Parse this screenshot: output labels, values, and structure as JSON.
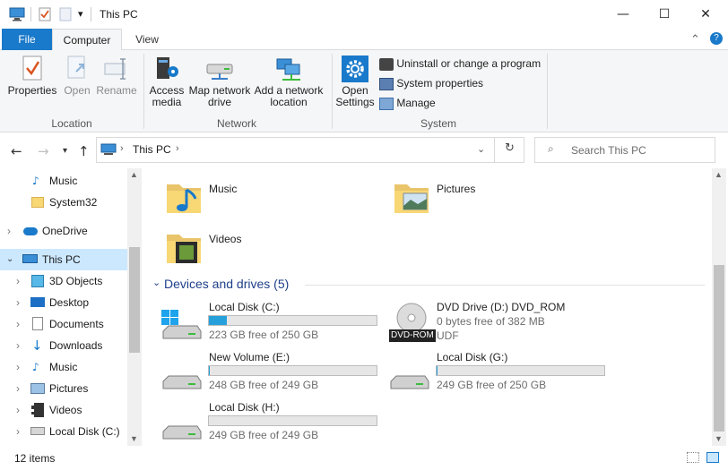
{
  "titlebar": {
    "title": "This PC",
    "minimize": "—",
    "maximize": "☐",
    "close": "✕",
    "dropdown": "▾"
  },
  "tabs": {
    "file": "File",
    "computer": "Computer",
    "view": "View",
    "collapse": "⌃",
    "help": "?"
  },
  "ribbon": {
    "properties": "Properties",
    "open": "Open",
    "rename": "Rename",
    "access_media": "Access media",
    "map_network_drive": "Map network drive",
    "add_network_location": "Add a network location",
    "open_settings": "Open Settings",
    "uninstall": "Uninstall or change a program",
    "system_properties": "System properties",
    "manage": "Manage",
    "groups": {
      "location": "Location",
      "network": "Network",
      "system": "System"
    }
  },
  "address": {
    "crumb": "This PC",
    "search_placeholder": "Search This PC"
  },
  "nav": {
    "items": [
      {
        "label": "Music",
        "icon": "music-icon"
      },
      {
        "label": "System32",
        "icon": "folder-icon"
      },
      {
        "label": "OneDrive",
        "icon": "cloud-icon"
      },
      {
        "label": "This PC",
        "icon": "computer-icon"
      },
      {
        "label": "3D Objects",
        "icon": "cube-icon"
      },
      {
        "label": "Desktop",
        "icon": "desktop-icon"
      },
      {
        "label": "Documents",
        "icon": "document-icon"
      },
      {
        "label": "Downloads",
        "icon": "download-icon"
      },
      {
        "label": "Music",
        "icon": "music-icon"
      },
      {
        "label": "Pictures",
        "icon": "pictures-icon"
      },
      {
        "label": "Videos",
        "icon": "video-icon"
      },
      {
        "label": "Local Disk (C:)",
        "icon": "drive-icon"
      }
    ]
  },
  "folders": [
    {
      "name": "Music",
      "icon": "music-folder-icon"
    },
    {
      "name": "Pictures",
      "icon": "pictures-folder-icon"
    },
    {
      "name": "Videos",
      "icon": "videos-folder-icon"
    }
  ],
  "devices": {
    "header": "Devices and drives (5)",
    "drives": [
      {
        "name": "Local Disk (C:)",
        "free": "223 GB free of 250 GB",
        "used_fraction": 0.108
      },
      {
        "name": "New Volume (E:)",
        "free": "248 GB free of 249 GB",
        "used_fraction": 0.004
      },
      {
        "name": "Local Disk (G:)",
        "free": "249 GB free of 250 GB",
        "used_fraction": 0.004
      },
      {
        "name": "Local Disk (H:)",
        "free": "249 GB free of 249 GB",
        "used_fraction": 0.0
      }
    ],
    "dvd": {
      "name": "DVD Drive (D:) DVD_ROM",
      "free": "0 bytes free of 382 MB",
      "fs": "UDF",
      "badge": "DVD-ROM"
    }
  },
  "status": {
    "count": "12 items"
  },
  "colors": {
    "accent": "#1979ca",
    "selection": "#cce8ff",
    "progress": "#26a0da"
  }
}
